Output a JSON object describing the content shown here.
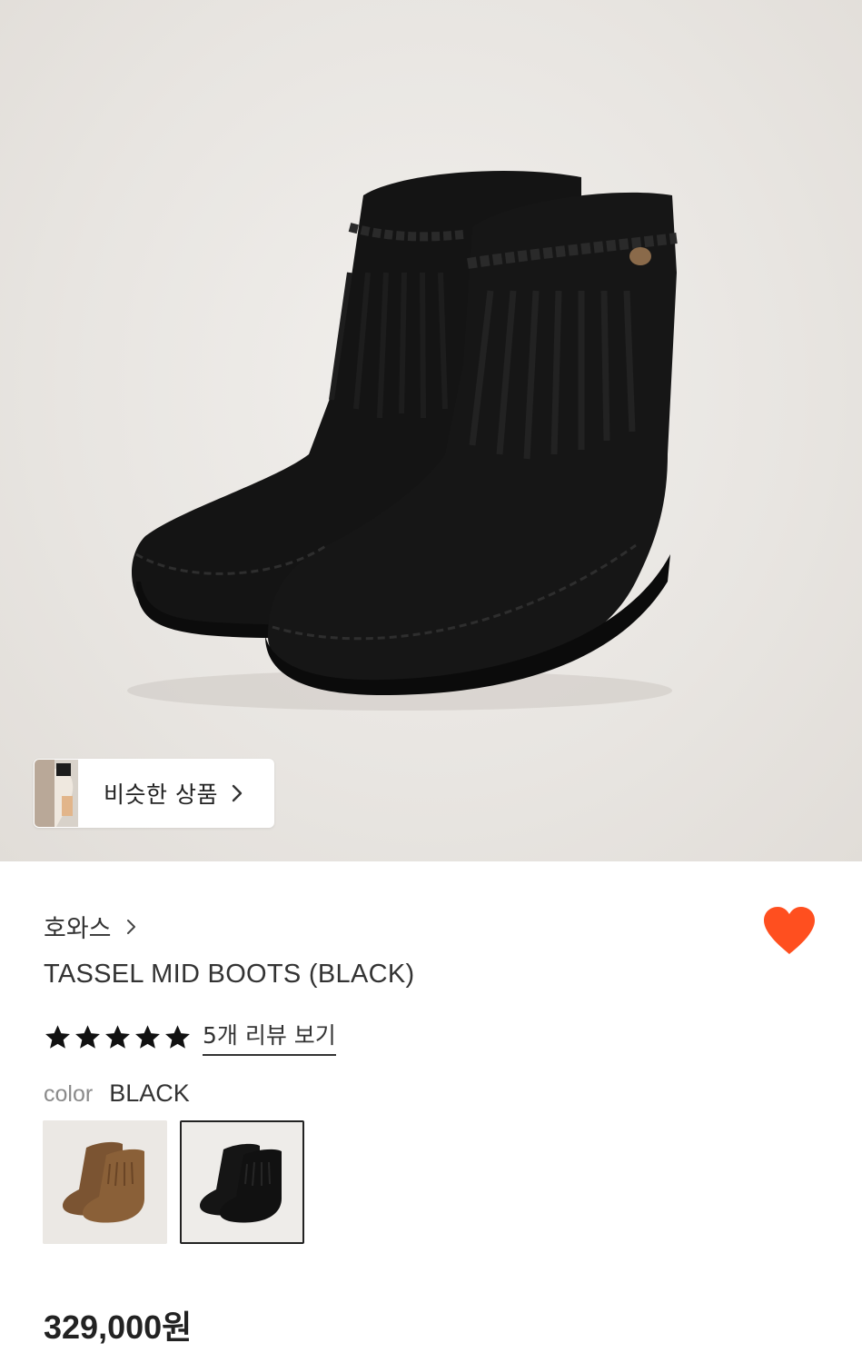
{
  "similar": {
    "label": "비슷한 상품",
    "icon": "chevron-right-icon"
  },
  "product": {
    "brand": "호와스",
    "name": "TASSEL MID BOOTS (BLACK)",
    "rating": 5,
    "review_link": "5개 리뷰 보기",
    "color_label": "color",
    "color_value": "BLACK",
    "price": "329,000원",
    "wishlist_color": "#ff4f1f"
  },
  "swatches": [
    {
      "name": "brown",
      "selected": false
    },
    {
      "name": "black",
      "selected": true
    }
  ]
}
